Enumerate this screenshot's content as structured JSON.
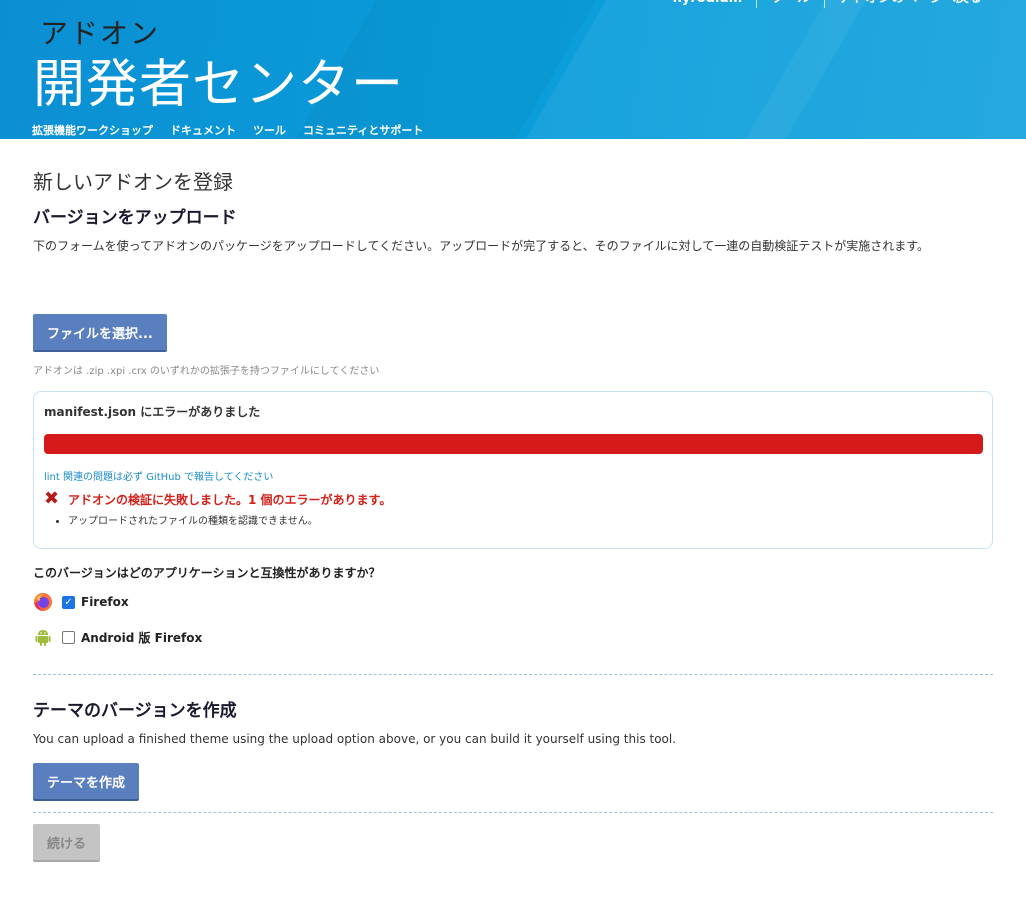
{
  "header": {
    "logo_small": "アドオン",
    "logo_big": "開発者センター",
    "top_links": [
      "hyrodium",
      "ツール",
      "アドオンのページへ戻る"
    ],
    "nav": [
      "拡張機能ワークショップ",
      "ドキュメント",
      "ツール",
      "コミュニティとサポート"
    ]
  },
  "page": {
    "title": "新しいアドオンを登録",
    "upload_section_title": "バージョンをアップロード",
    "upload_description": "下のフォームを使ってアドオンのパッケージをアップロードしてください。アップロードが完了すると、そのファイルに対して一連の自動検証テストが実施されます。",
    "choose_file_label": "ファイルを選択...",
    "file_hint": "アドオンは .zip .xpi .crx のいずれかの拡張子を持つファイルにしてください"
  },
  "validation": {
    "title": "manifest.json にエラーがありました",
    "progress": 1.0,
    "progress_color": "#d51a1a",
    "lint_link": "lint 関連の問題は必ず GitHub で報告してください",
    "error_icon": "x-icon",
    "error_summary": "アドオンの検証に失敗しました。1 個のエラーがあります。",
    "errors": [
      "アップロードされたファイルの種類を認識できません。"
    ]
  },
  "compat": {
    "question": "このバージョンはどのアプリケーションと互換性がありますか？",
    "apps": [
      {
        "icon": "firefox-icon",
        "label": "Firefox",
        "checked": true
      },
      {
        "icon": "android-icon",
        "label": "Android 版 Firefox",
        "checked": false
      }
    ]
  },
  "theme": {
    "title": "テーマのバージョンを作成",
    "description": "You can upload a finished theme using the upload option above, or you can build it yourself using this tool.",
    "create_label": "テーマを作成"
  },
  "footer": {
    "continue_label": "続ける"
  },
  "colors": {
    "header_blue": "#0a9ad9",
    "button_blue": "#5a7fbf",
    "error_red": "#d3201a"
  }
}
